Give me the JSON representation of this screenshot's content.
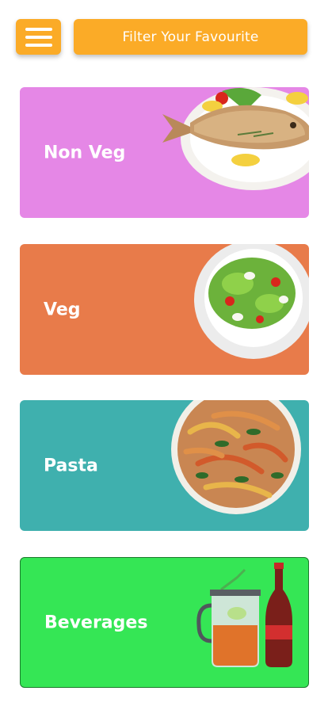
{
  "header": {
    "menu_icon": "hamburger-menu-icon",
    "filter_label": "Filter Your Favourite",
    "accent_color": "#fbab27"
  },
  "categories": [
    {
      "label": "Non Veg",
      "color": "#e587e6",
      "image": "grilled-fish-plate"
    },
    {
      "label": "Veg",
      "color": "#e87b4a",
      "image": "green-salad-bowl"
    },
    {
      "label": "Pasta",
      "color": "#3fb0ae",
      "image": "pasta-plate"
    },
    {
      "label": "Beverages",
      "color": "#35e655",
      "image": "drinks-glass-and-cola-bottle"
    }
  ]
}
